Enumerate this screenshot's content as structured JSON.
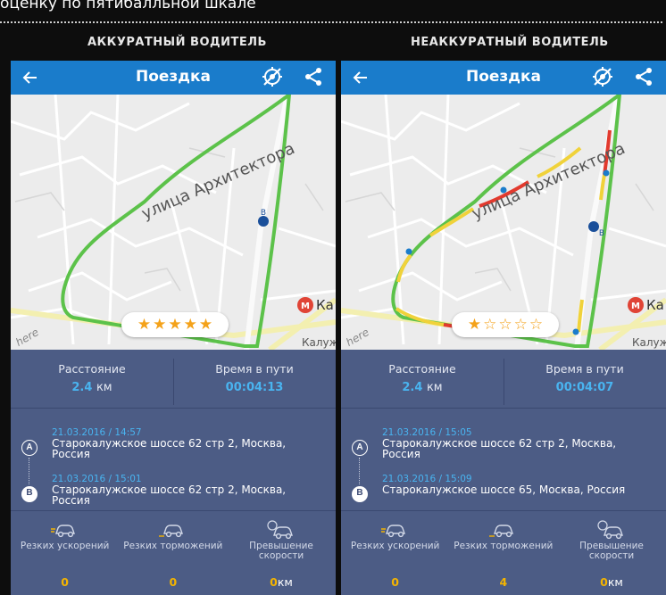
{
  "header": {
    "text": "оценку по пятибалльной шкале"
  },
  "columns": [
    {
      "title": "АККУРАТНЫЙ ВОДИТЕЛЬ",
      "app": {
        "title": "Поездка",
        "rating": 5,
        "stars": [
          "★",
          "★",
          "★",
          "★",
          "★"
        ],
        "distance_label": "Расстояние",
        "distance_value": "2.4",
        "distance_unit": "км",
        "time_label": "Время в пути",
        "time_value": "00:04:13",
        "point_a": {
          "marker": "A",
          "date": "21.03.2016 / 14:57",
          "address": "Старокалужское шоссе 62 стр 2, Москва, Россия"
        },
        "point_b": {
          "marker": "B",
          "date": "21.03.2016 / 15:01",
          "address": "Старокалужское шоссе 62 стр 2, Москва, Россия"
        },
        "events": [
          {
            "label": "Резких ускорений",
            "value": "0",
            "unit": ""
          },
          {
            "label": "Резких торможений",
            "value": "0",
            "unit": ""
          },
          {
            "label": "Превышение скорости",
            "value": "0",
            "unit": "км"
          }
        ],
        "map": {
          "street": "улица Архитектора",
          "metro": "Ка",
          "road": "Калуж",
          "watermark": "here",
          "marker_b": "B"
        }
      }
    },
    {
      "title": "НЕАККУРАТНЫЙ ВОДИТЕЛЬ",
      "app": {
        "title": "Поездка",
        "rating": 1,
        "stars": [
          "★",
          "☆",
          "☆",
          "☆",
          "☆"
        ],
        "distance_label": "Расстояние",
        "distance_value": "2.4",
        "distance_unit": "км",
        "time_label": "Время в пути",
        "time_value": "00:04:07",
        "point_a": {
          "marker": "A",
          "date": "21.03.2016 / 15:05",
          "address": "Старокалужское шоссе 62 стр 2, Москва, Россия"
        },
        "point_b": {
          "marker": "B",
          "date": "21.03.2016 / 15:09",
          "address": "Старокалужское шоссе 65, Москва, Россия"
        },
        "events": [
          {
            "label": "Резких ускорений",
            "value": "0",
            "unit": ""
          },
          {
            "label": "Резких торможений",
            "value": "4",
            "unit": ""
          },
          {
            "label": "Превышение скорости",
            "value": "0",
            "unit": "км"
          }
        ],
        "map": {
          "street": "улица Архитектора",
          "metro": "Ка",
          "road": "Калуж",
          "watermark": "here",
          "marker_b": "B"
        }
      }
    }
  ],
  "colors": {
    "accent": "#1a7ccb",
    "panel": "#4c5c85",
    "value_blue": "#49b4f0",
    "value_yellow": "#f4b400",
    "star": "#f4a21a",
    "route_green": "#5cc24a"
  },
  "icons": {
    "back": "back-arrow-icon",
    "gps_off": "gps-off-icon",
    "share": "share-icon",
    "car": "car-icon"
  }
}
